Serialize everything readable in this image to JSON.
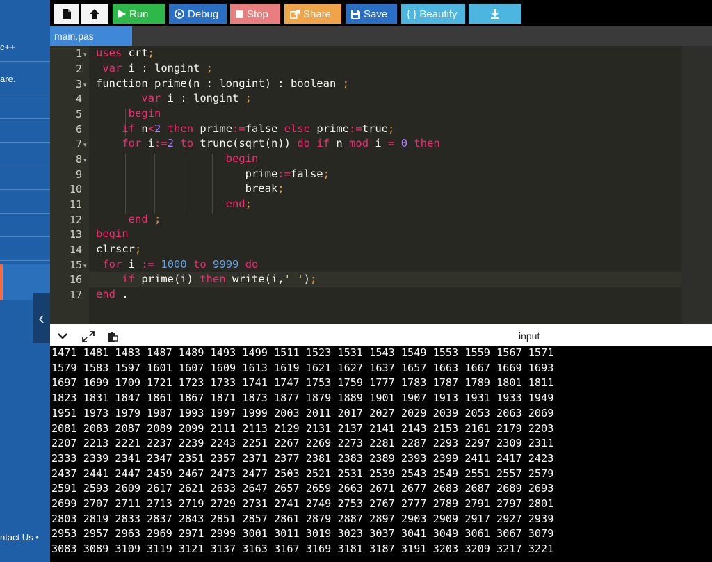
{
  "sidebar": {
    "items": [
      {
        "label": "c++"
      },
      {
        "label": "are."
      },
      {
        "label": "ntact Us •"
      }
    ]
  },
  "toolbar": {
    "new_file_icon": "file-icon",
    "upload_icon": "upload-icon",
    "run_label": "Run",
    "debug_label": "Debug",
    "stop_label": "Stop",
    "share_label": "Share",
    "save_label": "Save",
    "beautify_label": "{ } Beautify",
    "download_icon": "download-icon",
    "colors": {
      "run": "#2fb84a",
      "debug": "#2a6fc4",
      "stop": "#e87e7e",
      "share": "#f0a44a",
      "save": "#2a6fc4",
      "beautify": "#4cb6e0",
      "download": "#4cb6e0"
    }
  },
  "tab": {
    "label": "main.pas"
  },
  "editor": {
    "lines": [
      "1",
      "2",
      "3",
      "4",
      "5",
      "6",
      "7",
      "8",
      "9",
      "10",
      "11",
      "12",
      "13",
      "14",
      "15",
      "16",
      "17"
    ]
  },
  "output_panel": {
    "input_label": "input",
    "lines": [
      "1471 1481 1483 1487 1489 1493 1499 1511 1523 1531 1543 1549 1553 1559 1567 1571",
      "1579 1583 1597 1601 1607 1609 1613 1619 1621 1627 1637 1657 1663 1667 1669 1693",
      "1697 1699 1709 1721 1723 1733 1741 1747 1753 1759 1777 1783 1787 1789 1801 1811",
      "1823 1831 1847 1861 1867 1871 1873 1877 1879 1889 1901 1907 1913 1931 1933 1949",
      "1951 1973 1979 1987 1993 1997 1999 2003 2011 2017 2027 2029 2039 2053 2063 2069",
      "2081 2083 2087 2089 2099 2111 2113 2129 2131 2137 2141 2143 2153 2161 2179 2203",
      "2207 2213 2221 2237 2239 2243 2251 2267 2269 2273 2281 2287 2293 2297 2309 2311",
      "2333 2339 2341 2347 2351 2357 2371 2377 2381 2383 2389 2393 2399 2411 2417 2423",
      "2437 2441 2447 2459 2467 2473 2477 2503 2521 2531 2539 2543 2549 2551 2557 2579",
      "2591 2593 2609 2617 2621 2633 2647 2657 2659 2663 2671 2677 2683 2687 2689 2693",
      "2699 2707 2711 2713 2719 2729 2731 2741 2749 2753 2767 2777 2789 2791 2797 2801",
      "2803 2819 2833 2837 2843 2851 2857 2861 2879 2887 2897 2903 2909 2917 2927 2939",
      "2953 2957 2963 2969 2971 2999 3001 3011 3019 3023 3037 3041 3049 3061 3067 3079",
      "3083 3089 3109 3119 3121 3137 3163 3167 3169 3181 3187 3191 3203 3209 3217 3221"
    ]
  }
}
